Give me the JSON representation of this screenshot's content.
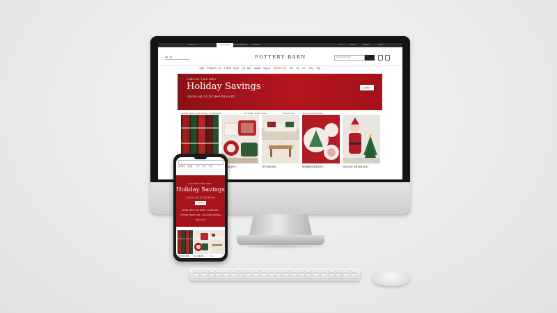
{
  "desktop": {
    "tabs": [
      "ABOUT US",
      "POTTERY BARN",
      "POTTERY BARN KIDS",
      "WILLIAMS"
    ],
    "top_links": [
      "로그인",
      "회원가입",
      "마이페이지",
      "고객센터"
    ],
    "country_label": "KR · ₩",
    "logo": "POTTERY BARN",
    "search_placeholder": "검색어를 입력하세요",
    "nav": [
      "신상품",
      "주방&다이닝",
      "가구",
      "인테리어",
      "패브릭",
      "조명",
      "욕실",
      "Holiday",
      "아웃도어",
      "홀리데이 기프트",
      "세일",
      "키즈",
      "틴즈",
      "브랜드",
      "매장"
    ],
    "banner": {
      "kicker": "LIMITED TIME ONLY",
      "title": "Holiday Savings",
      "subtitle": "크리스마스 소품, 가구, 침구, 패브릭 최대 50% 할인",
      "button": "쇼핑하기"
    },
    "sublinks": [
      "MORE FROM OUR FAMILY OF BRANDS",
      "POTTERY BARN KIDS",
      "WEST ELM",
      "WILLIAMS SONOMA"
    ],
    "tiles": [
      {
        "caption": "패브릭 최대 50% ›",
        "palette": "plaid"
      },
      {
        "caption": "침구 최대 30% ›",
        "palette": "pillows"
      },
      {
        "caption": "가구 최대 30% ›",
        "palette": "livingroom"
      },
      {
        "caption": "테이블웨어 최대 50% ›",
        "palette": "tableware"
      },
      {
        "caption": "크리스마스 소품 최대 50% ›",
        "palette": "santa"
      }
    ]
  },
  "phone": {
    "nav": [
      "홀리데이",
      "신상품",
      "가구",
      "침구",
      "주방"
    ],
    "banner": {
      "kicker": "LIMITED TIME ONLY",
      "title": "Holiday Savings",
      "subtitle": "크리스마스 소품, 가구, 침구 최대 50%",
      "button": "쇼핑하기"
    },
    "links": [
      "MORE FROM OUR FAMILY OF BRANDS",
      "POTTERY BARN KIDS · WILLIAMS SONOMA",
      "WEST ELM"
    ],
    "tiles": [
      {
        "caption": "패브릭 최대 50% ›"
      },
      {
        "caption": "침구 최대 30% ›"
      },
      {
        "caption": "가구 ›"
      }
    ]
  },
  "colors": {
    "banner_red": "#a51219",
    "dark": "#141414"
  }
}
